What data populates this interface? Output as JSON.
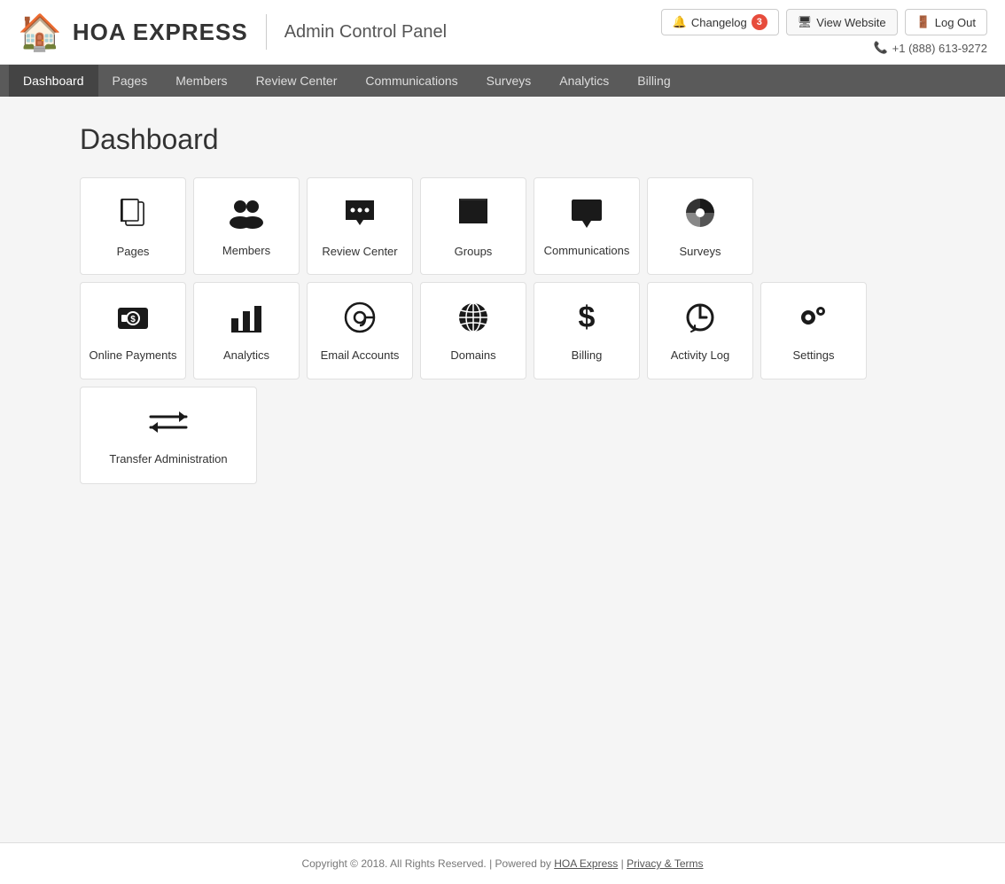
{
  "header": {
    "logo_text": "HOA EXPRESS",
    "admin_title": "Admin Control Panel",
    "changelog_label": "Changelog",
    "changelog_count": "3",
    "view_website_label": "View Website",
    "logout_label": "Log Out",
    "phone": "+1 (888) 613-9272"
  },
  "navbar": {
    "items": [
      {
        "label": "Dashboard",
        "active": true
      },
      {
        "label": "Pages",
        "active": false
      },
      {
        "label": "Members",
        "active": false
      },
      {
        "label": "Review Center",
        "active": false
      },
      {
        "label": "Communications",
        "active": false
      },
      {
        "label": "Surveys",
        "active": false
      },
      {
        "label": "Analytics",
        "active": false
      },
      {
        "label": "Billing",
        "active": false
      }
    ]
  },
  "page": {
    "title": "Dashboard"
  },
  "dashboard": {
    "row1": [
      {
        "label": "Pages",
        "icon": "pages-icon"
      },
      {
        "label": "Members",
        "icon": "members-icon"
      },
      {
        "label": "Review Center",
        "icon": "review-icon"
      },
      {
        "label": "Groups",
        "icon": "groups-icon"
      },
      {
        "label": "Communications",
        "icon": "communications-icon"
      },
      {
        "label": "Surveys",
        "icon": "surveys-icon"
      }
    ],
    "row2": [
      {
        "label": "Online Payments",
        "icon": "payments-icon"
      },
      {
        "label": "Analytics",
        "icon": "analytics-icon"
      },
      {
        "label": "Email Accounts",
        "icon": "email-icon"
      },
      {
        "label": "Domains",
        "icon": "domains-icon"
      },
      {
        "label": "Billing",
        "icon": "billing-icon"
      },
      {
        "label": "Activity Log",
        "icon": "activity-icon"
      },
      {
        "label": "Settings",
        "icon": "settings-icon"
      }
    ],
    "row3": [
      {
        "label": "Transfer Administration",
        "icon": "transfer-icon",
        "wide": true
      }
    ]
  },
  "footer": {
    "copyright": "Copyright © 2018. All Rights Reserved.  |  Powered by ",
    "link_label": "HOA Express",
    "separator": " | ",
    "privacy_label": "Privacy & Terms"
  }
}
